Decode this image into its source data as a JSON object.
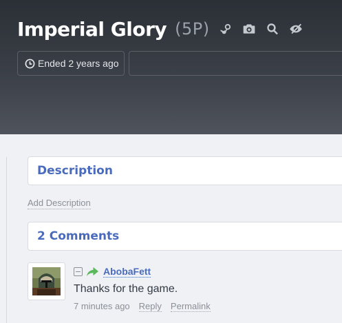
{
  "header": {
    "title": "Imperial Glory",
    "players": "(5P)",
    "icons": [
      "steam-icon",
      "camera-icon",
      "search-icon",
      "hidden-eye-icon"
    ],
    "status": "Ended 2 years ago"
  },
  "description": {
    "heading": "Description",
    "add_link": "Add Description"
  },
  "comments": {
    "heading": "2 Comments",
    "items": [
      {
        "author": "AbobaFett",
        "text": "Thanks for the game.",
        "time": "7 minutes ago",
        "reply_label": "Reply",
        "permalink_label": "Permalink"
      }
    ]
  },
  "colors": {
    "accent": "#4a6bbd",
    "share": "#5cb85c",
    "header_bg": "#3b4048"
  }
}
